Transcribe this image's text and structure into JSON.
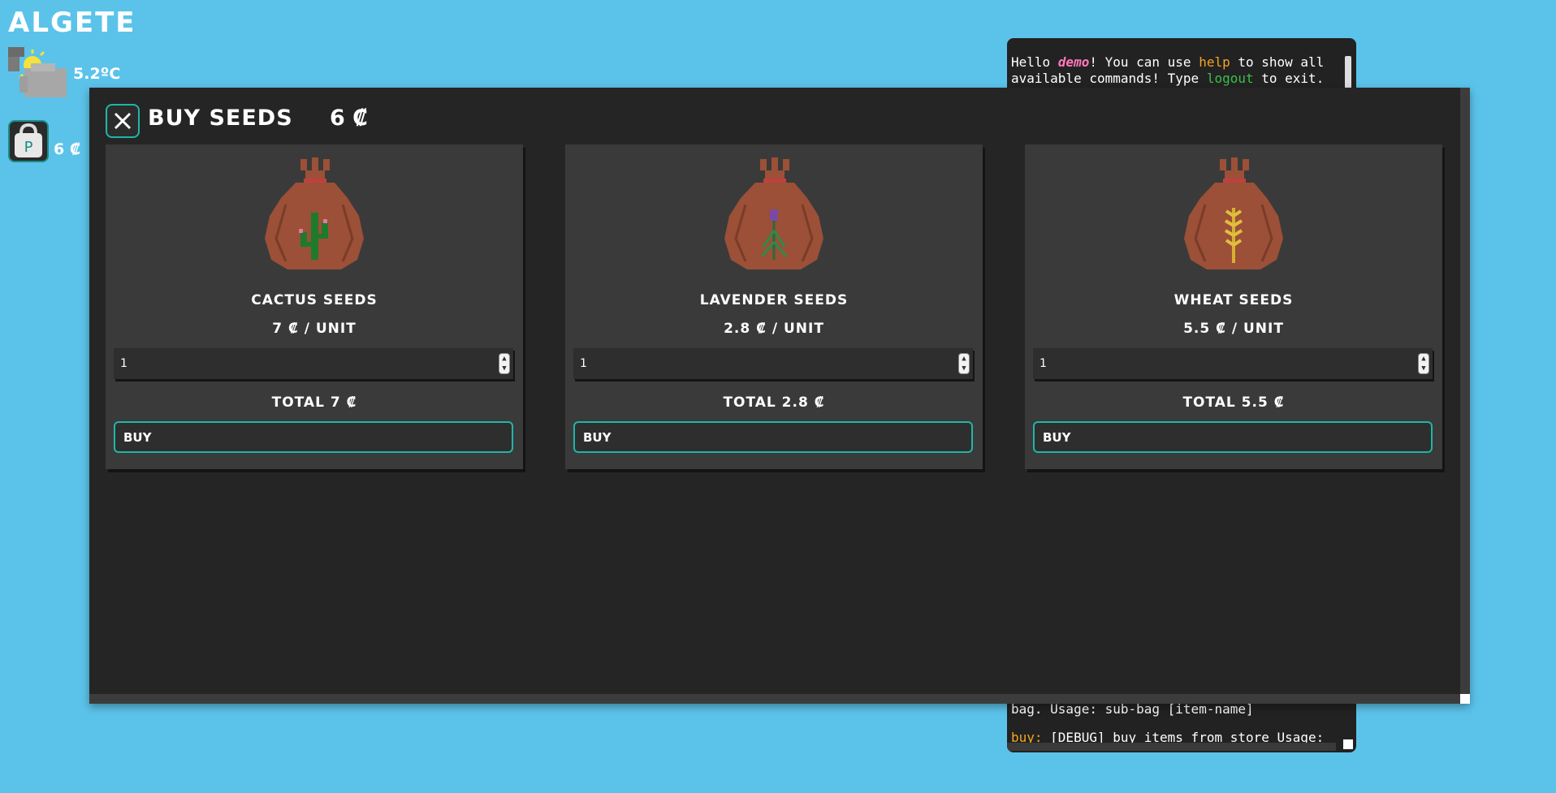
{
  "hud": {
    "city": "ALGETE",
    "temperature": "5.2ºC",
    "bag_letter": "P",
    "money": "6 ₡"
  },
  "terminal": {
    "line1_prefix": "Hello ",
    "user": "demo",
    "line1_mid": "! You can use ",
    "help_cmd": "help",
    "line1_suffix": " to show all",
    "line2_prefix": "available commands! Type ",
    "logout_cmd": "logout",
    "line2_suffix": " to exit.",
    "line3": "bag. Usage: sub-bag [item-name]",
    "line4_cmd": "buy:",
    "line4_text": " [DEBUG] buy items from store Usage:"
  },
  "modal": {
    "title": "BUY SEEDS",
    "money": "6 ₡"
  },
  "cards": [
    {
      "name": "CACTUS SEEDS",
      "price": "7 ₡ / UNIT",
      "quantity": "1",
      "total": "TOTAL 7 ₡",
      "buy_label": "BUY",
      "plant": "cactus",
      "plant_color": "#1f7a2c"
    },
    {
      "name": "LAVENDER SEEDS",
      "price": "2.8 ₡ / UNIT",
      "quantity": "1",
      "total": "TOTAL 2.8 ₡",
      "buy_label": "BUY",
      "plant": "lavender",
      "plant_color": "#7a4aa3"
    },
    {
      "name": "WHEAT SEEDS",
      "price": "5.5 ₡ / UNIT",
      "quantity": "1",
      "total": "TOTAL 5.5 ₡",
      "buy_label": "BUY",
      "plant": "wheat",
      "plant_color": "#d8b030"
    }
  ],
  "colors": {
    "background": "#5bc3ea",
    "modal": "#252525",
    "card": "#3a3a3a",
    "accent": "#1fb6a8",
    "bag": "#9b5037"
  }
}
